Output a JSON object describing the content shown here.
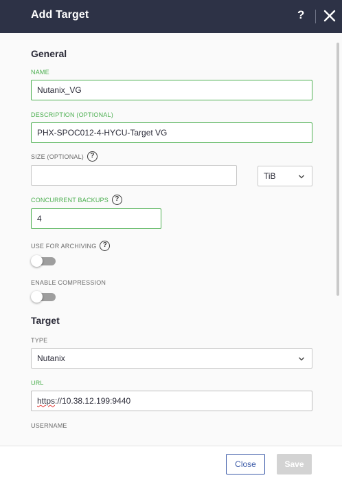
{
  "dialog": {
    "title": "Add Target",
    "help_label": "?",
    "close_icon": "close-icon"
  },
  "general": {
    "heading": "General",
    "name_label": "NAME",
    "name_value": "Nutanix_VG",
    "description_label": "DESCRIPTION (OPTIONAL)",
    "description_value": "PHX-SPOC012-4-HYCU-Target VG",
    "size_label": "SIZE (OPTIONAL)",
    "size_value": "",
    "size_unit": "TiB",
    "concurrent_label": "CONCURRENT BACKUPS",
    "concurrent_value": "4",
    "archiving_label": "USE FOR ARCHIVING",
    "archiving_enabled": false,
    "compression_label": "ENABLE COMPRESSION",
    "compression_enabled": false
  },
  "target": {
    "heading": "Target",
    "type_label": "TYPE",
    "type_value": "Nutanix",
    "url_label": "URL",
    "url_prefix": "https",
    "url_rest": "://10.38.12.199:9440",
    "username_label": "USERNAME"
  },
  "footer": {
    "close_label": "Close",
    "save_label": "Save"
  },
  "colors": {
    "header_bg": "#2d3246",
    "accent_green": "#4caf50",
    "primary_blue": "#3b5aa8",
    "disabled_gray": "#d3d3d3"
  }
}
